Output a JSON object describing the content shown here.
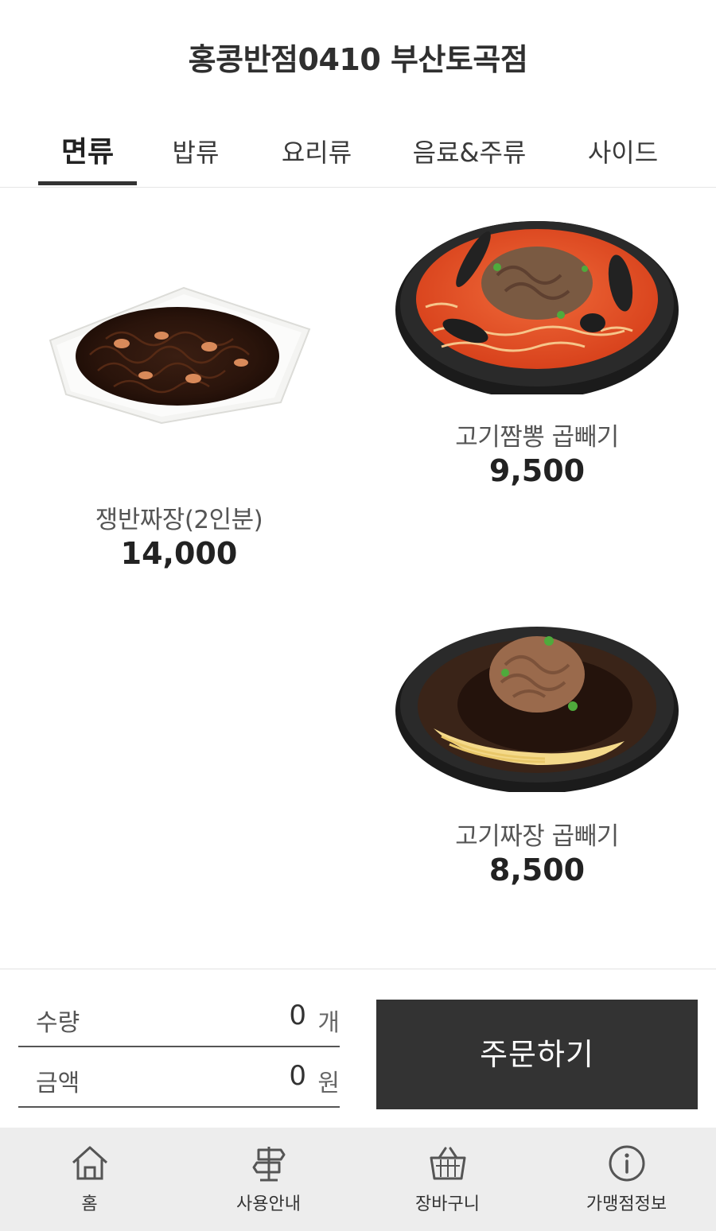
{
  "header": {
    "title": "홍콩반점0410 부산토곡점"
  },
  "tabs": [
    {
      "label": "면류",
      "active": true
    },
    {
      "label": "밥류",
      "active": false
    },
    {
      "label": "요리류",
      "active": false
    },
    {
      "label": "음료&주류",
      "active": false
    },
    {
      "label": "사이드",
      "active": false
    }
  ],
  "menu": [
    {
      "name": "쟁반짜장(2인분)",
      "price": "14,000",
      "image": "tray-jajang-photo"
    },
    {
      "name": "고기짬뽕 곱빼기",
      "price": "9,500",
      "image": "jjamppong-bowl-photo"
    },
    {
      "name": "고기짜장 곱빼기",
      "price": "8,500",
      "image": "jajang-bowl-photo"
    }
  ],
  "summary": {
    "quantity_label": "수량",
    "quantity_value": "0",
    "quantity_unit": "개",
    "amount_label": "금액",
    "amount_value": "0",
    "amount_unit": "원",
    "order_button": "주문하기"
  },
  "nav": [
    {
      "label": "홈",
      "icon": "home-icon"
    },
    {
      "label": "사용안내",
      "icon": "signpost-icon"
    },
    {
      "label": "장바구니",
      "icon": "basket-icon"
    },
    {
      "label": "가맹점정보",
      "icon": "info-icon"
    }
  ],
  "colors": {
    "dark": "#333333",
    "nav_bg": "#ededed",
    "text": "#2b2b2b"
  }
}
